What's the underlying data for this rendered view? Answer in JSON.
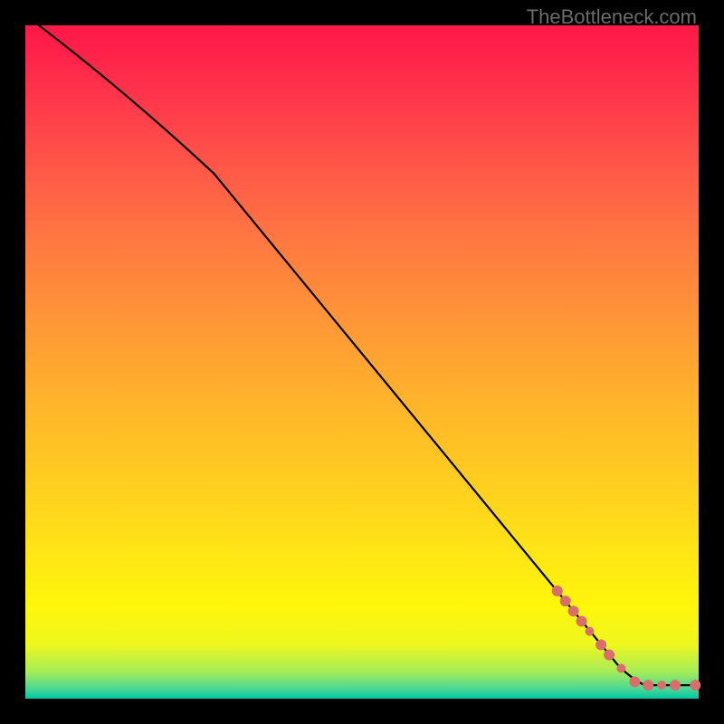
{
  "attribution": "TheBottleneck.com",
  "chart_data": {
    "type": "line",
    "title": "",
    "xlabel": "",
    "ylabel": "",
    "xlim": [
      0,
      100
    ],
    "ylim": [
      0,
      100
    ],
    "series": [
      {
        "name": "curve",
        "stroke": "#000000",
        "points": [
          {
            "x": 2,
            "y": 100
          },
          {
            "x": 28,
            "y": 78
          },
          {
            "x": 88,
            "y": 5
          },
          {
            "x": 92,
            "y": 2
          },
          {
            "x": 100,
            "y": 2
          }
        ]
      }
    ],
    "scatter": {
      "name": "markers",
      "color": "#d96f6d",
      "points": [
        {
          "x": 79.0,
          "y": 16.0,
          "r": 6
        },
        {
          "x": 80.2,
          "y": 14.5,
          "r": 6
        },
        {
          "x": 81.4,
          "y": 13.0,
          "r": 6
        },
        {
          "x": 82.6,
          "y": 11.5,
          "r": 6
        },
        {
          "x": 83.8,
          "y": 10.0,
          "r": 5
        },
        {
          "x": 85.5,
          "y": 8.0,
          "r": 6
        },
        {
          "x": 86.7,
          "y": 6.5,
          "r": 6
        },
        {
          "x": 88.5,
          "y": 4.5,
          "r": 5
        },
        {
          "x": 90.5,
          "y": 2.5,
          "r": 6
        },
        {
          "x": 92.5,
          "y": 2.0,
          "r": 6
        },
        {
          "x": 94.5,
          "y": 2.0,
          "r": 5
        },
        {
          "x": 96.5,
          "y": 2.0,
          "r": 6
        },
        {
          "x": 99.5,
          "y": 2.0,
          "r": 6
        }
      ]
    }
  }
}
